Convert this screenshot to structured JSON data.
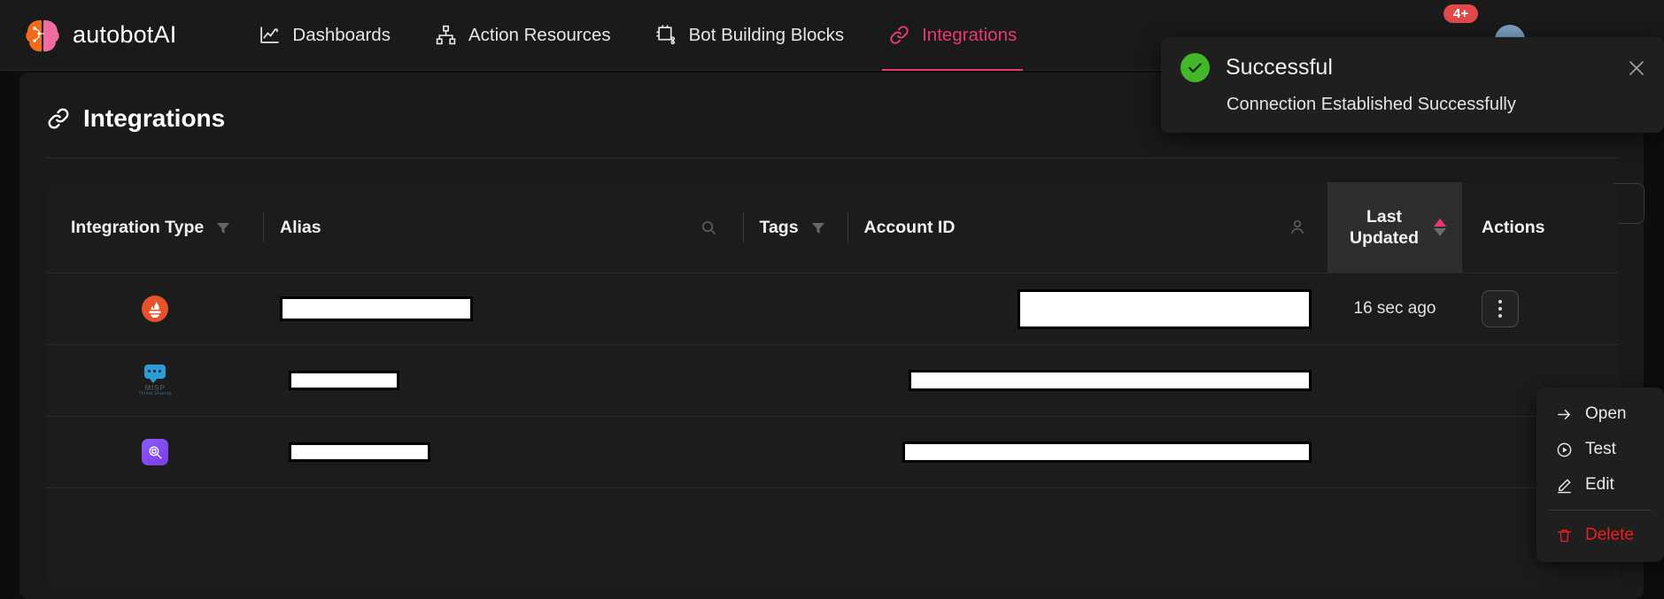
{
  "brand": {
    "name": "autobotAI",
    "logo_icon": "brain-logo-icon"
  },
  "nav": {
    "items": [
      {
        "label": "Dashboards",
        "icon": "chart-line-icon",
        "active": false
      },
      {
        "label": "Action Resources",
        "icon": "hierarchy-icon",
        "active": false
      },
      {
        "label": "Bot Building Blocks",
        "icon": "bot-blocks-icon",
        "active": false
      },
      {
        "label": "Integrations",
        "icon": "link-chain-icon",
        "active": true
      }
    ],
    "notification_badge": "4+",
    "avatar_icon": "user-avatar"
  },
  "page": {
    "title": "Integrations",
    "title_icon": "link-chain-icon"
  },
  "table": {
    "headers": {
      "integration_type": "Integration Type",
      "alias": "Alias",
      "tags": "Tags",
      "account_id": "Account ID",
      "last_updated": "Last Updated",
      "actions": "Actions"
    },
    "header_icons": {
      "type_filter": "filter-funnel-icon",
      "alias_search": "search-icon",
      "tags_filter": "filter-funnel-icon",
      "account_person": "person-icon",
      "sort_asc": "sort-ascending-arrow",
      "sort_desc": "sort-descending-arrow"
    },
    "rows": [
      {
        "type_icon": "prometheus-icon",
        "alias": "",
        "tags": "",
        "account_id": "",
        "last_updated": "16 sec ago",
        "action_icon": "kebab-menu-icon"
      },
      {
        "type_icon": "misp-threat-sharing-icon",
        "alias": "",
        "tags": "",
        "account_id": "",
        "last_updated": "",
        "action_icon": "kebab-menu-icon"
      },
      {
        "type_icon": "purple-search-icon",
        "alias": "",
        "tags": "",
        "account_id": "",
        "last_updated": "",
        "action_icon": "kebab-menu-icon"
      }
    ]
  },
  "context_menu": {
    "items": [
      {
        "label": "Open",
        "icon": "arrow-right-icon",
        "danger": false
      },
      {
        "label": "Test",
        "icon": "play-circle-icon",
        "danger": false
      },
      {
        "label": "Edit",
        "icon": "pencil-icon",
        "danger": false
      },
      {
        "label": "Delete",
        "icon": "trash-icon",
        "danger": true
      }
    ]
  },
  "toast": {
    "title": "Successful",
    "message": "Connection Established Successfully",
    "status_icon": "check-circle-icon",
    "close_icon": "close-x-icon"
  },
  "colors": {
    "accent_pink": "#e8396e",
    "success_green": "#42b72a",
    "danger_red": "#f01b1b",
    "badge_red": "#e04a4a",
    "background": "#0d0d0d",
    "surface": "#1a1a1a"
  }
}
